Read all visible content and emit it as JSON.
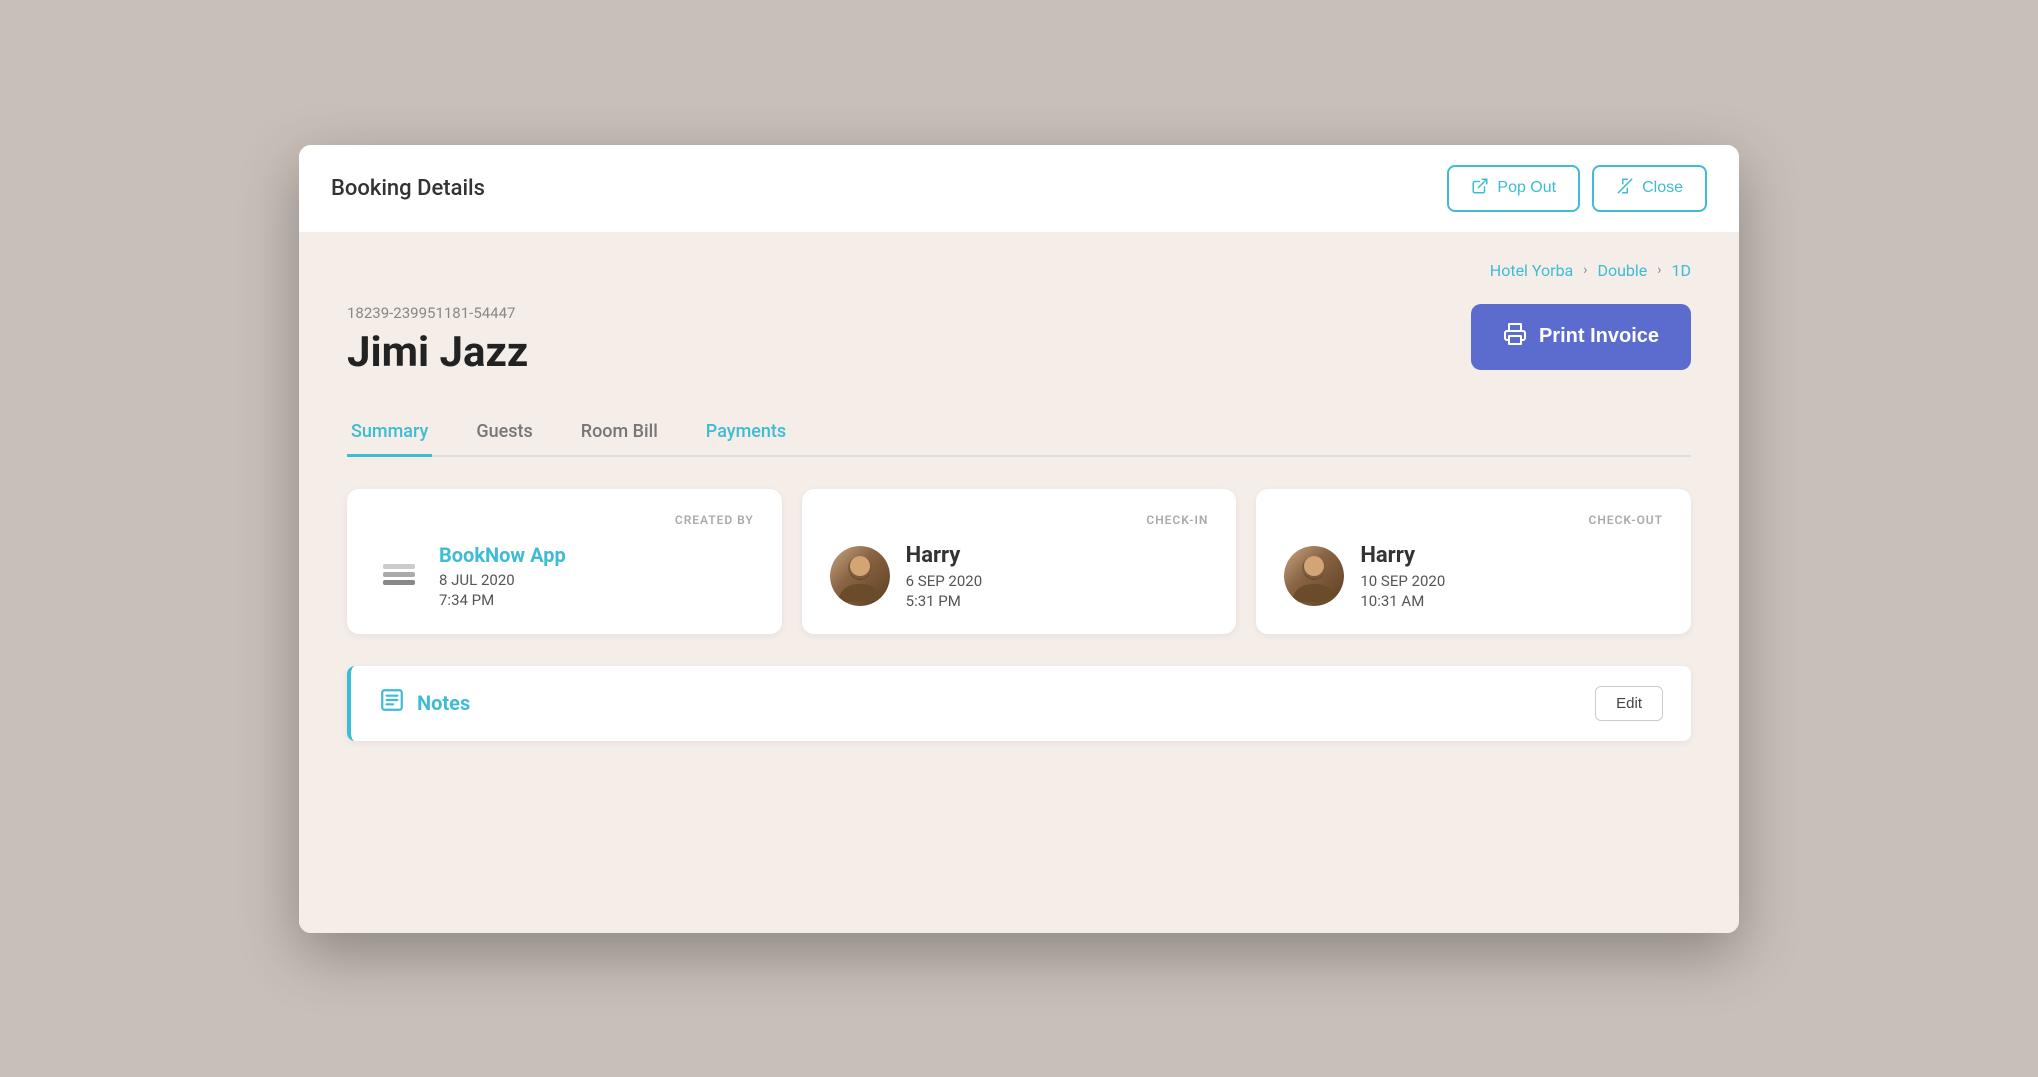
{
  "modal": {
    "title": "Booking Details",
    "popout_label": "Pop Out",
    "close_label": "Close"
  },
  "breadcrumb": {
    "hotel": "Hotel Yorba",
    "room_type": "Double",
    "room_id": "1D",
    "sep": "›"
  },
  "booking": {
    "id": "18239-239951181-54447",
    "guest_name": "Jimi Jazz",
    "print_invoice_label": "Print Invoice"
  },
  "tabs": [
    {
      "label": "Summary",
      "active": true
    },
    {
      "label": "Guests",
      "active": false
    },
    {
      "label": "Room Bill",
      "active": false
    },
    {
      "label": "Payments",
      "active": false
    }
  ],
  "cards": {
    "created_by": {
      "label": "CREATED BY",
      "creator_name": "BookNow App",
      "date": "8 JUL 2020",
      "time": "7:34 PM"
    },
    "check_in": {
      "label": "CHECK-IN",
      "person_name": "Harry",
      "date": "6 SEP 2020",
      "time": "5:31 PM"
    },
    "check_out": {
      "label": "CHECK-OUT",
      "person_name": "Harry",
      "date": "10 SEP 2020",
      "time": "10:31 AM"
    }
  },
  "notes": {
    "label": "Notes",
    "edit_label": "Edit"
  },
  "icons": {
    "popout": "↗",
    "close": "↙",
    "print": "🖨",
    "layers": "⊟",
    "notes": "📋"
  }
}
